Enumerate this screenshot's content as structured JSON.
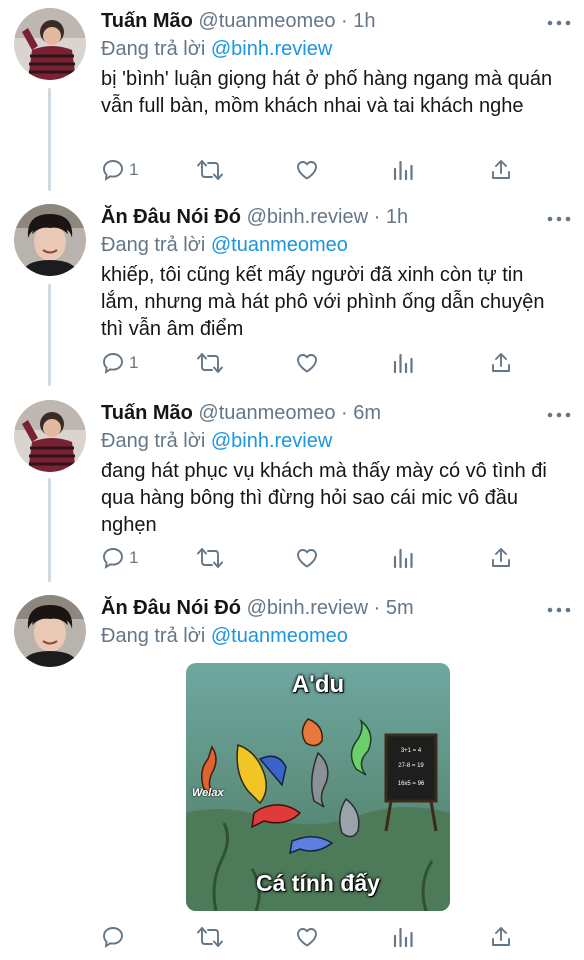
{
  "tweets": [
    {
      "display_name": "Tuấn Mão",
      "handle": "@tuanmeomeo",
      "separator": "·",
      "time": "1h",
      "reply_prefix": "Đang trả lời",
      "reply_to": "@binh.review",
      "text": "bị 'bình' luận giọng hát ở phố hàng ngang mà quán vẫn full bàn, mồm khách nhai và tai khách nghe",
      "reply_count": "1",
      "avatar": "avatar-striped-shirt"
    },
    {
      "display_name": "Ăn Đâu Nói Đó",
      "handle": "@binh.review",
      "separator": "·",
      "time": "1h",
      "reply_prefix": "Đang trả lời",
      "reply_to": "@tuanmeomeo",
      "text": "khiếp, tôi cũng kết mấy người đã xinh còn tự tin lắm, nhưng mà hát phô với phình ống dẫn chuyện thì vẫn âm điểm",
      "reply_count": "1",
      "avatar": "avatar-dark-hair"
    },
    {
      "display_name": "Tuấn Mão",
      "handle": "@tuanmeomeo",
      "separator": "·",
      "time": "6m",
      "reply_prefix": "Đang trả lời",
      "reply_to": "@binh.review",
      "text": "đang hát phục vụ khách mà thấy mày có vô tình đi qua hàng bông thì đừng hỏi sao cái mic vô đầu nghẹn",
      "reply_count": "1",
      "avatar": "avatar-striped-shirt"
    },
    {
      "display_name": "Ăn Đâu Nói Đó",
      "handle": "@binh.review",
      "separator": "·",
      "time": "5m",
      "reply_prefix": "Đang trả lời",
      "reply_to": "@tuanmeomeo",
      "reply_count": "",
      "avatar": "avatar-dark-hair",
      "media": {
        "caption_top": "A'du",
        "caption_bottom": "Cá tính đấy",
        "watermark": "Welax",
        "board_lines": [
          "3+1 = 4",
          "27-8 = 19",
          "16x5 = 96"
        ]
      }
    }
  ],
  "icons": {
    "reply": "comment-icon",
    "retweet": "retweet-icon",
    "like": "heart-icon",
    "analytics": "analytics-icon",
    "share": "share-icon",
    "more": "more-dots-icon"
  },
  "colors": {
    "text": "#14171a",
    "muted": "#657786",
    "mention": "#1b95e0",
    "thread_line": "#cfd9de"
  }
}
